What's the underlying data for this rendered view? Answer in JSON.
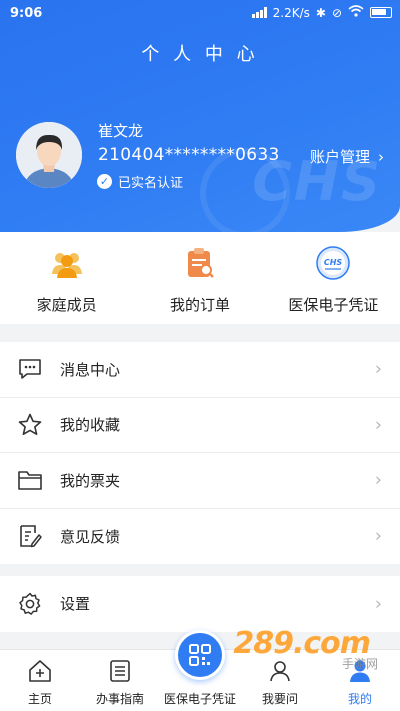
{
  "status_bar": {
    "time": "9:06",
    "network_speed": "2.2K/s",
    "icons": [
      "bluetooth-icon",
      "mute-icon",
      "wifi-icon",
      "battery-icon"
    ]
  },
  "header": {
    "title": "个 人 中 心",
    "brand_deco": "CHS"
  },
  "user": {
    "name": "崔文龙",
    "id_number": "210404********0633",
    "verified_label": "已实名认证",
    "account_link_label": "账户管理"
  },
  "quick_actions": [
    {
      "label": "家庭成员",
      "icon": "family-members-icon"
    },
    {
      "label": "我的订单",
      "icon": "order-icon"
    },
    {
      "label": "医保电子凭证",
      "icon": "chs-voucher-icon"
    }
  ],
  "menu_primary": [
    {
      "label": "消息中心",
      "icon": "message-icon"
    },
    {
      "label": "我的收藏",
      "icon": "star-icon"
    },
    {
      "label": "我的票夹",
      "icon": "folder-icon"
    },
    {
      "label": "意见反馈",
      "icon": "feedback-icon"
    }
  ],
  "menu_secondary": [
    {
      "label": "设置",
      "icon": "gear-icon"
    }
  ],
  "tabbar": {
    "tabs": [
      {
        "label": "主页",
        "icon": "home-icon"
      },
      {
        "label": "办事指南",
        "icon": "guide-icon"
      },
      {
        "label": "医保电子凭证",
        "icon": "qr-code-icon"
      },
      {
        "label": "我要问",
        "icon": "ask-icon"
      },
      {
        "label": "我的",
        "icon": "profile-icon",
        "active": true
      }
    ]
  },
  "watermark": {
    "text": "289.com",
    "sub": "手游网"
  },
  "colors": {
    "primary": "#2f7cf3",
    "orange": "#f5a623",
    "text": "#222222",
    "chevron": "#b8b8b8"
  }
}
